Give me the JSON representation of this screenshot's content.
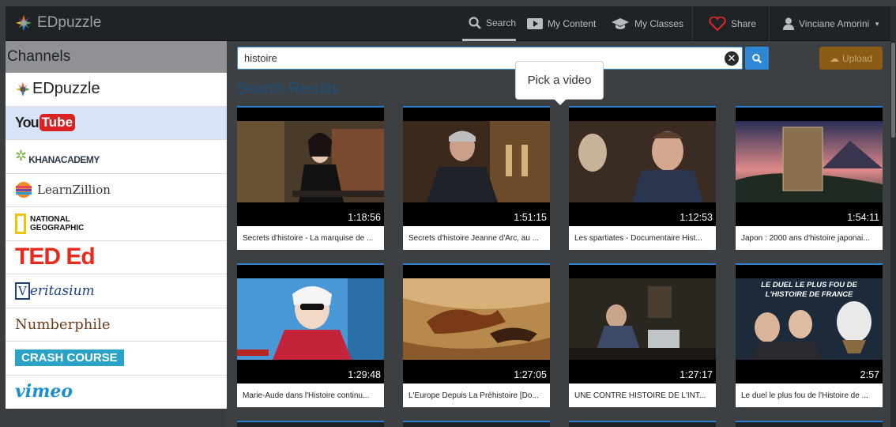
{
  "brand": {
    "name": "EDpuzzle"
  },
  "nav": {
    "search": "Search",
    "my_content": "My Content",
    "my_classes": "My Classes",
    "share": "Share",
    "user": "Vinciane Amorini"
  },
  "sidebar": {
    "title": "Channels",
    "channels": [
      "EDpuzzle",
      "YouTube",
      "KHANACADEMY",
      "LearnZillion",
      "NATIONAL GEOGRAPHIC",
      "TED Ed",
      "Veritasium",
      "Numberphile",
      "CRASH COURSE",
      "vimeo"
    ]
  },
  "search": {
    "value": "histoire"
  },
  "upload_label": "Upload",
  "results_title": "Search Results",
  "tooltip": "Pick a video",
  "videos": [
    {
      "duration": "1:18:56",
      "title": "Secrets d'histoire - La marquise de ..."
    },
    {
      "duration": "1:51:15",
      "title": "Secrets d'histoire Jeanne d'Arc, au ..."
    },
    {
      "duration": "1:12:53",
      "title": "Les spartiates - Documentaire Hist..."
    },
    {
      "duration": "1:54:11",
      "title": "Japon : 2000 ans d'histoire japonai..."
    },
    {
      "duration": "1:29:48",
      "title": "Marie-Aude dans l'Histoire continu..."
    },
    {
      "duration": "1:27:05",
      "title": "L'Europe Depuis La Préhistoire [Do..."
    },
    {
      "duration": "1:27:17",
      "title": "UNE CONTRE HISTOIRE DE L'INT..."
    },
    {
      "duration": "2:57",
      "title": "Le duel le plus fou de l'Histoire de ..."
    }
  ],
  "thumb_caption": "LE DUEL LE PLUS FOU DE L'HISTOIRE DE FRANCE"
}
